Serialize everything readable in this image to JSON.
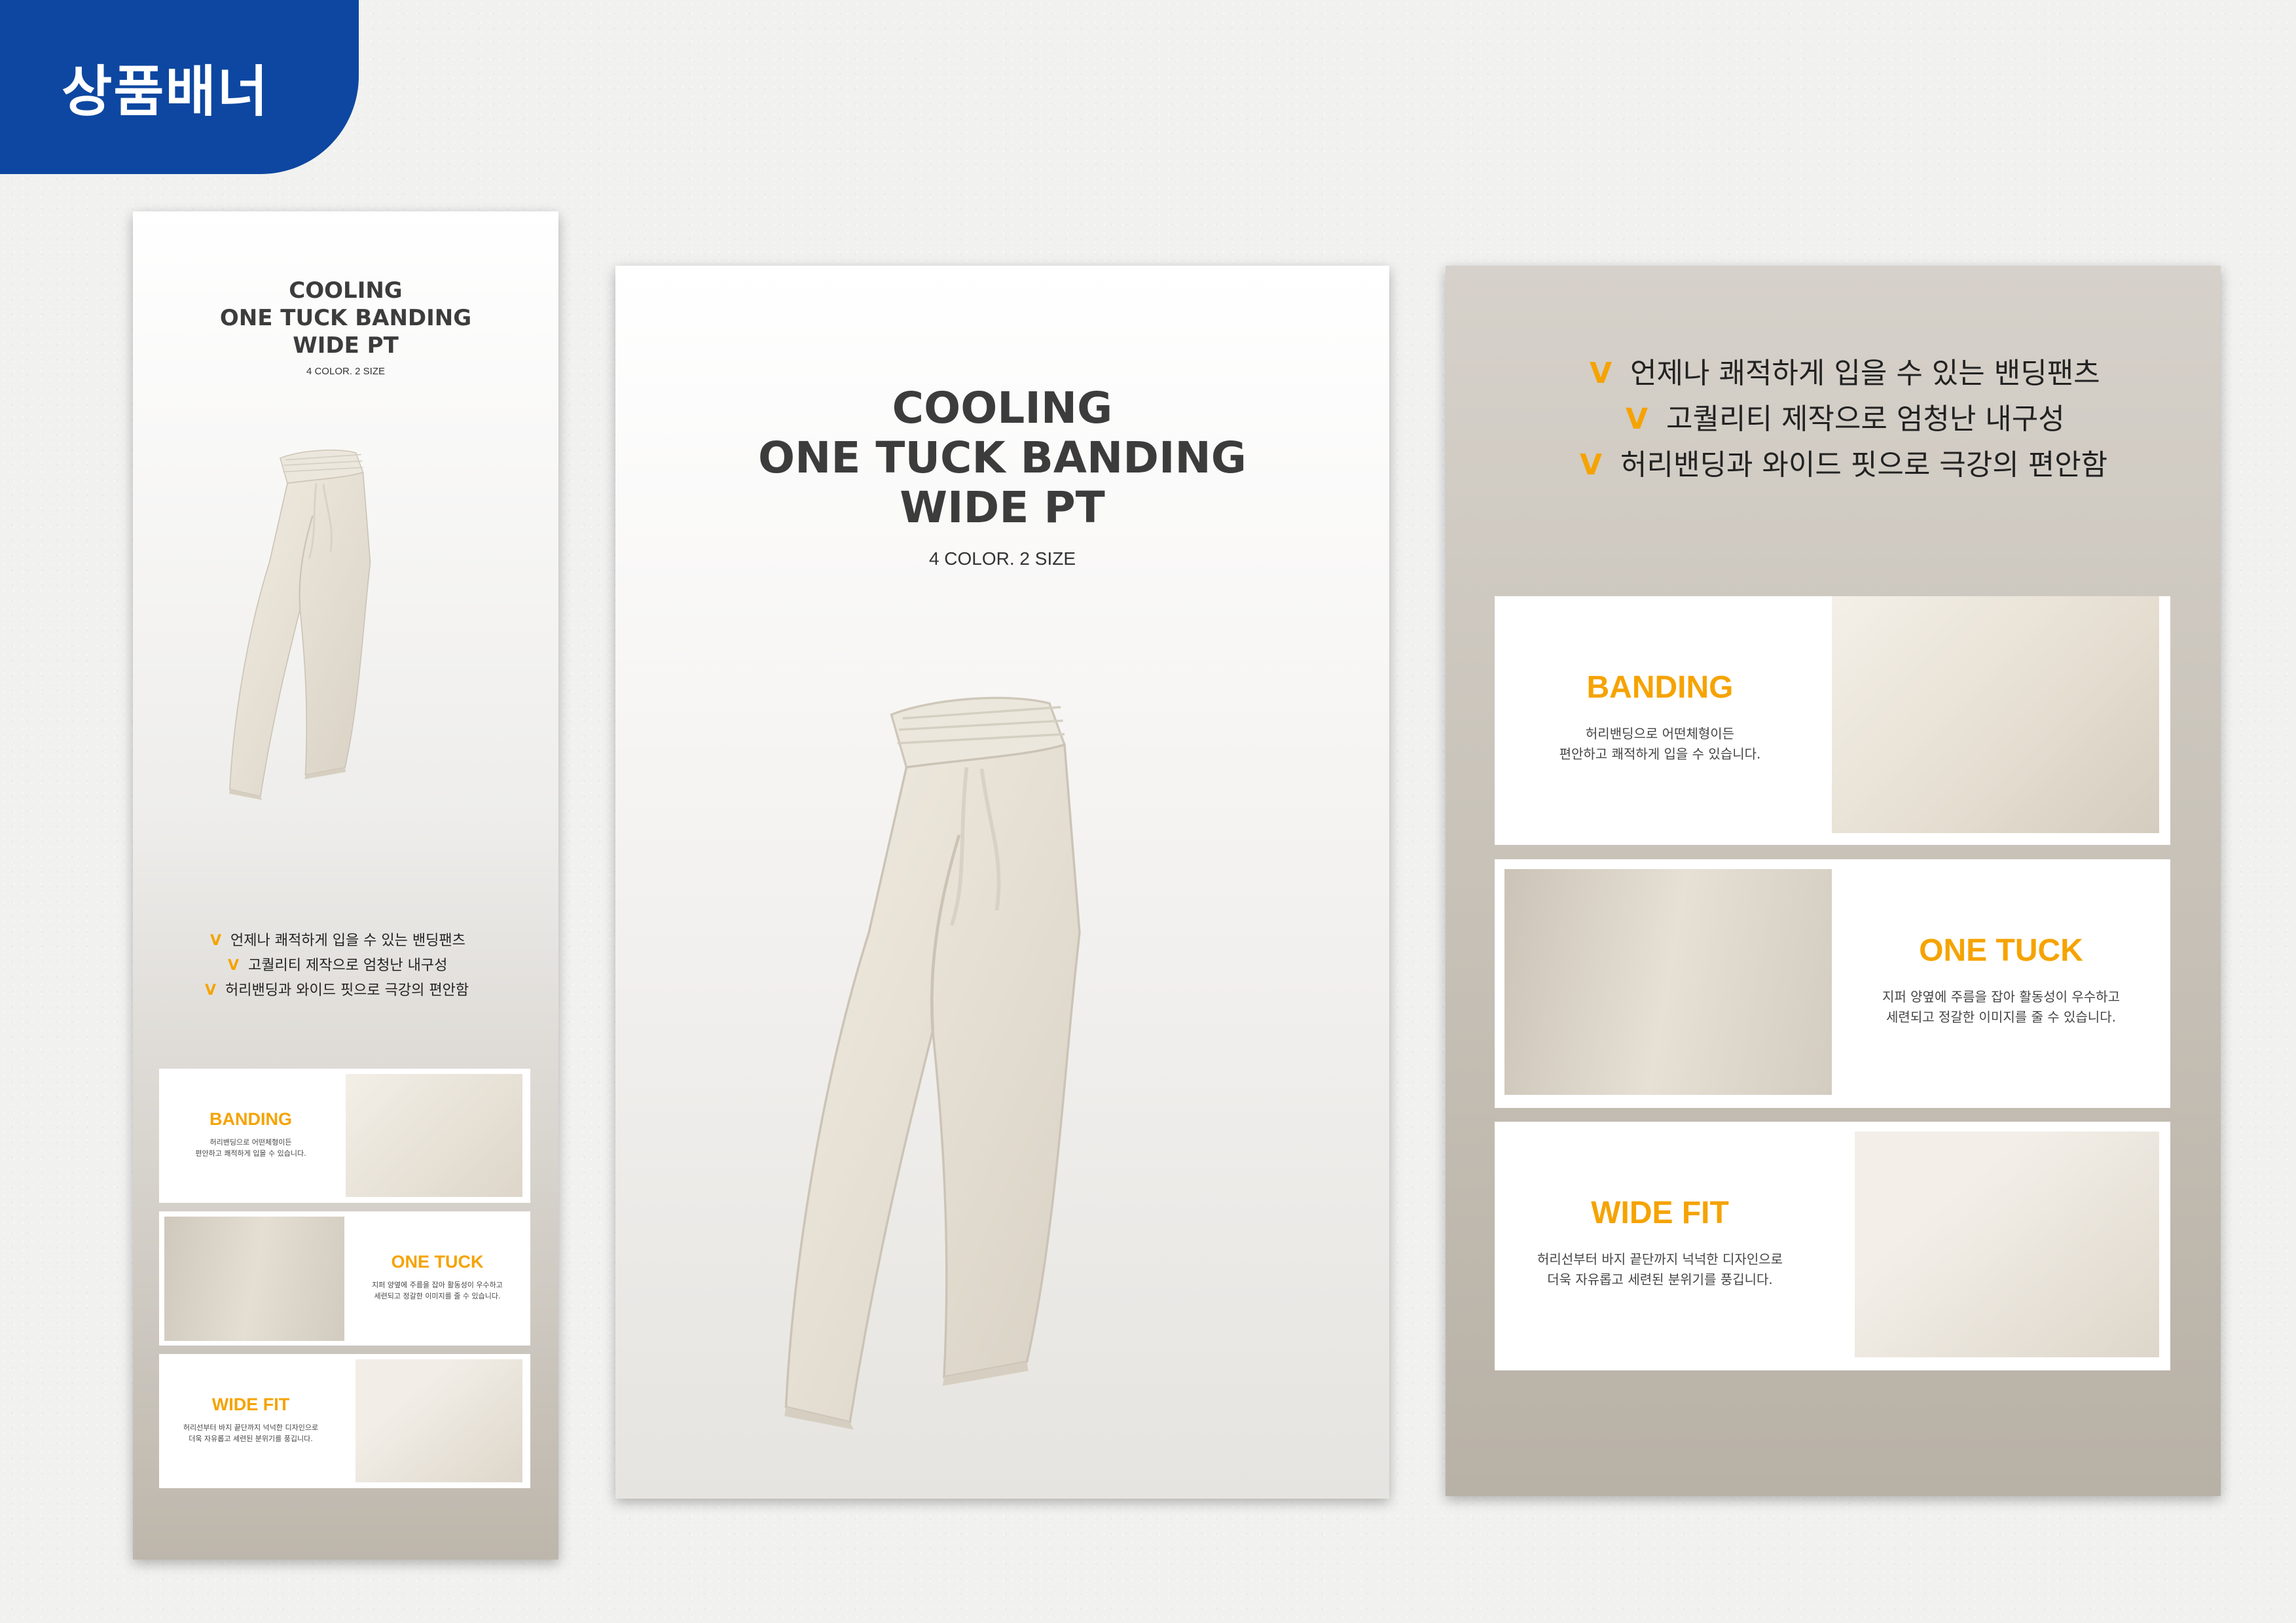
{
  "tag": {
    "label": "상품배너"
  },
  "product": {
    "title_lines": [
      "COOLING",
      "ONE TUCK BANDING",
      "WIDE PT"
    ],
    "subtitle": "4 COLOR. 2 SIZE"
  },
  "bullets": {
    "mark": "V",
    "items": [
      "언제나 쾌적하게 입을 수 있는 밴딩팬츠",
      "고퀄리티 제작으로 엄청난 내구성",
      "허리밴딩과 와이드 핏으로 극강의 편안함"
    ]
  },
  "features": [
    {
      "title": "BANDING",
      "desc": [
        "허리밴딩으로 어떤체형이든",
        "편안하고 쾌적하게 입을 수 있습니다."
      ]
    },
    {
      "title": "ONE TUCK",
      "desc": [
        "지퍼 양옆에 주름을 잡아 활동성이 우수하고",
        "세련되고 정갈한 이미지를 줄 수 있습니다."
      ]
    },
    {
      "title": "WIDE FIT",
      "desc": [
        "허리선부터 바지 끝단까지 넉넉한 디자인으로",
        "더욱 자유롭고 세련된 분위기를 풍깁니다."
      ]
    }
  ],
  "colors": {
    "tag_bg": "#0d47a1",
    "accent": "#f5a300",
    "fabric": "#e8e2d6"
  },
  "icons": [
    "pants-photo",
    "waistband-closeup",
    "drawstring-closeup",
    "hem-closeup"
  ]
}
